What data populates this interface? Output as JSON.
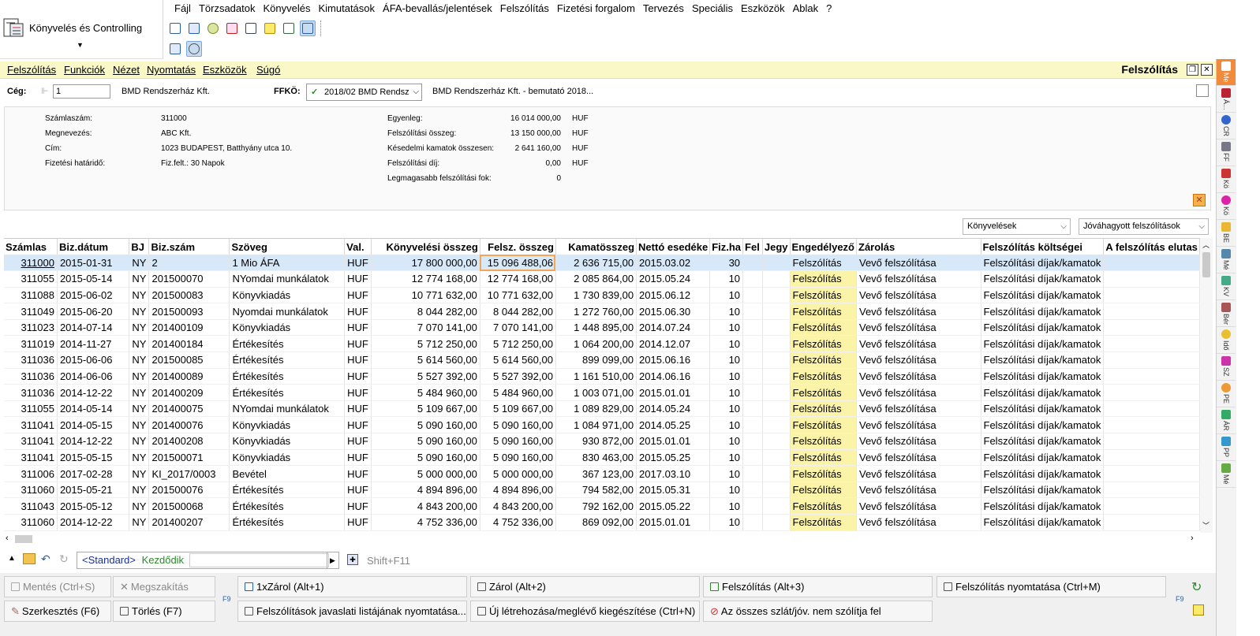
{
  "app": {
    "title": "Könyvelés és Controlling"
  },
  "main_menu": [
    "Fájl",
    "Törzsadatok",
    "Könyvelés",
    "Kimutatások",
    "ÁFA-bevallás/jelentések",
    "Felszólítás",
    "Fizetési forgalom",
    "Tervezés",
    "Speciális",
    "Eszközök",
    "Ablak",
    "?"
  ],
  "window": {
    "menu": [
      "Felszólítás",
      "Funkciók",
      "Nézet",
      "Nyomtatás",
      "Eszközök",
      "Súgó"
    ],
    "title": "Felszólítás"
  },
  "filter": {
    "ceg_label": "Cég:",
    "ceg_value": "1",
    "ceg_name": "BMD Rendszerház Kft.",
    "ffko_label": "FFKÖ:",
    "ffko_value": "2018/02 BMD Rendsz",
    "ffko_desc": "BMD Rendszerház Kft. - bemutató 2018..."
  },
  "info": {
    "left": [
      {
        "k": "Számlaszám:",
        "v": "311000"
      },
      {
        "k": "Megnevezés:",
        "v": "ABC Kft."
      },
      {
        "k": "Cím:",
        "v": "1023 BUDAPEST, Batthyány utca 10."
      },
      {
        "k": "Fizetési határidő:",
        "v": "Fiz.felt.: 30 Napok"
      }
    ],
    "right": [
      {
        "k": "Egyenleg:",
        "v": "16 014 000,00",
        "c": "HUF"
      },
      {
        "k": "Felszólítási összeg:",
        "v": "13 150 000,00",
        "c": "HUF"
      },
      {
        "k": "Késedelmi kamatok összesen:",
        "v": "2 641 160,00",
        "c": "HUF"
      },
      {
        "k": "Felszólítási díj:",
        "v": "0,00",
        "c": "HUF"
      },
      {
        "k": "Legmagasabb felszólítási fok:",
        "v": "0",
        "c": ""
      }
    ]
  },
  "combos": {
    "left": "Könyvelések",
    "right": "Jóváhagyott felszólítások"
  },
  "table": {
    "columns": [
      "Számlas",
      "Biz.dátum",
      "BJ",
      "Biz.szám",
      "Szöveg",
      "Val.",
      "Könyvelési összeg",
      "Felsz. összeg",
      "Kamatösszeg",
      "Nettó esedéke",
      "Fiz.ha",
      "Fel",
      "Jegy",
      "Engedélyező",
      "Zárolás",
      "Felszólítás költségei",
      "A felszólítás elutas"
    ],
    "rows": [
      [
        "311000",
        "2015-01-31",
        "NY",
        "2",
        "1 Mio ÁFA",
        "HUF",
        "17 800 000,00",
        "15 096 488,06",
        "2 636 715,00",
        "2015.03.02",
        "30",
        "",
        "",
        "Felszólítás",
        "Vevő felszólítása",
        "Felszólítási díjak/kamatok",
        ""
      ],
      [
        "311055",
        "2015-05-14",
        "NY",
        "201500070",
        "NYomdai munkálatok",
        "HUF",
        "12 774 168,00",
        "12 774 168,00",
        "2 085 864,00",
        "2015.05.24",
        "10",
        "",
        "",
        "Felszólítás",
        "Vevő felszólítása",
        "Felszólítási díjak/kamatok",
        ""
      ],
      [
        "311088",
        "2015-06-02",
        "NY",
        "201500083",
        "Könyvkiadás",
        "HUF",
        "10 771 632,00",
        "10 771 632,00",
        "1 730 839,00",
        "2015.06.12",
        "10",
        "",
        "",
        "Felszólítás",
        "Vevő felszólítása",
        "Felszólítási díjak/kamatok",
        ""
      ],
      [
        "311049",
        "2015-06-20",
        "NY",
        "201500093",
        "Nyomdai munkálatok",
        "HUF",
        "8 044 282,00",
        "8 044 282,00",
        "1 272 760,00",
        "2015.06.30",
        "10",
        "",
        "",
        "Felszólítás",
        "Vevő felszólítása",
        "Felszólítási díjak/kamatok",
        ""
      ],
      [
        "311023",
        "2014-07-14",
        "NY",
        "201400109",
        "Könyvkiadás",
        "HUF",
        "7 070 141,00",
        "7 070 141,00",
        "1 448 895,00",
        "2014.07.24",
        "10",
        "",
        "",
        "Felszólítás",
        "Vevő felszólítása",
        "Felszólítási díjak/kamatok",
        ""
      ],
      [
        "311019",
        "2014-11-27",
        "NY",
        "201400184",
        "Értékesítés",
        "HUF",
        "5 712 250,00",
        "5 712 250,00",
        "1 064 200,00",
        "2014.12.07",
        "10",
        "",
        "",
        "Felszólítás",
        "Vevő felszólítása",
        "Felszólítási díjak/kamatok",
        ""
      ],
      [
        "311036",
        "2015-06-06",
        "NY",
        "201500085",
        "Értékesítés",
        "HUF",
        "5 614 560,00",
        "5 614 560,00",
        "899 099,00",
        "2015.06.16",
        "10",
        "",
        "",
        "Felszólítás",
        "Vevő felszólítása",
        "Felszólítási díjak/kamatok",
        ""
      ],
      [
        "311036",
        "2014-06-06",
        "NY",
        "201400089",
        "Értékesítés",
        "HUF",
        "5 527 392,00",
        "5 527 392,00",
        "1 161 510,00",
        "2014.06.16",
        "10",
        "",
        "",
        "Felszólítás",
        "Vevő felszólítása",
        "Felszólítási díjak/kamatok",
        ""
      ],
      [
        "311036",
        "2014-12-22",
        "NY",
        "201400209",
        "Értékesítés",
        "HUF",
        "5 484 960,00",
        "5 484 960,00",
        "1 003 071,00",
        "2015.01.01",
        "10",
        "",
        "",
        "Felszólítás",
        "Vevő felszólítása",
        "Felszólítási díjak/kamatok",
        ""
      ],
      [
        "311055",
        "2014-05-14",
        "NY",
        "201400075",
        "NYomdai munkálatok",
        "HUF",
        "5 109 667,00",
        "5 109 667,00",
        "1 089 829,00",
        "2014.05.24",
        "10",
        "",
        "",
        "Felszólítás",
        "Vevő felszólítása",
        "Felszólítási díjak/kamatok",
        ""
      ],
      [
        "311041",
        "2014-05-15",
        "NY",
        "201400076",
        "Könyvkiadás",
        "HUF",
        "5 090 160,00",
        "5 090 160,00",
        "1 084 971,00",
        "2014.05.25",
        "10",
        "",
        "",
        "Felszólítás",
        "Vevő felszólítása",
        "Felszólítási díjak/kamatok",
        ""
      ],
      [
        "311041",
        "2014-12-22",
        "NY",
        "201400208",
        "Könyvkiadás",
        "HUF",
        "5 090 160,00",
        "5 090 160,00",
        "930 872,00",
        "2015.01.01",
        "10",
        "",
        "",
        "Felszólítás",
        "Vevő felszólítása",
        "Felszólítási díjak/kamatok",
        ""
      ],
      [
        "311041",
        "2015-05-15",
        "NY",
        "201500071",
        "Könyvkiadás",
        "HUF",
        "5 090 160,00",
        "5 090 160,00",
        "830 463,00",
        "2015.05.25",
        "10",
        "",
        "",
        "Felszólítás",
        "Vevő felszólítása",
        "Felszólítási díjak/kamatok",
        ""
      ],
      [
        "311006",
        "2017-02-28",
        "NY",
        "KI_2017/0003",
        "Bevétel",
        "HUF",
        "5 000 000,00",
        "5 000 000,00",
        "367 123,00",
        "2017.03.10",
        "10",
        "",
        "",
        "Felszólítás",
        "Vevő felszólítása",
        "Felszólítási díjak/kamatok",
        ""
      ],
      [
        "311060",
        "2015-05-21",
        "NY",
        "201500076",
        "Értékesítés",
        "HUF",
        "4 894 896,00",
        "4 894 896,00",
        "794 582,00",
        "2015.05.31",
        "10",
        "",
        "",
        "Felszólítás",
        "Vevő felszólítása",
        "Felszólítási díjak/kamatok",
        ""
      ],
      [
        "311043",
        "2015-05-12",
        "NY",
        "201500068",
        "Értékesítés",
        "HUF",
        "4 843 200,00",
        "4 843 200,00",
        "792 162,00",
        "2015.05.22",
        "10",
        "",
        "",
        "Felszólítás",
        "Vevő felszólítása",
        "Felszólítási díjak/kamatok",
        ""
      ],
      [
        "311060",
        "2014-12-22",
        "NY",
        "201400207",
        "Értékesítés",
        "HUF",
        "4 752 336,00",
        "4 752 336,00",
        "869 092,00",
        "2015.01.01",
        "10",
        "",
        "",
        "Felszólítás",
        "Vevő felszólítása",
        "Felszólítási díjak/kamatok",
        ""
      ]
    ]
  },
  "search": {
    "standard": "<Standard>",
    "mode": "Kezdődik",
    "shortcut": "Shift+F11"
  },
  "actions": {
    "mentes": "Mentés (Ctrl+S)",
    "megszakitas": "Megszakítás",
    "szerkesztes": "Szerkesztés (F6)",
    "torles": "Törlés (F7)",
    "zarol1": "1xZárol (Alt+1)",
    "zarol2": "Zárol (Alt+2)",
    "felszolitas": "Felszólítás (Alt+3)",
    "nyomtatas": "Felszólítás nyomtatása (Ctrl+M)",
    "javaslat": "Felszólítások javaslati listájának nyomtatása...",
    "uj": "Új létrehozása/meglévő kiegészítése (Ctrl+N)",
    "osszes": "Az összes szlát/jóv. nem szólítja fel"
  },
  "right_tabs": [
    "Me",
    "Á...",
    "CR",
    "FF",
    "Kö",
    "Kö",
    "BE",
    "Mé",
    "KV",
    "Bér",
    "Idő",
    "SZ",
    "PE",
    "ÁR",
    "PP",
    "Mé"
  ]
}
